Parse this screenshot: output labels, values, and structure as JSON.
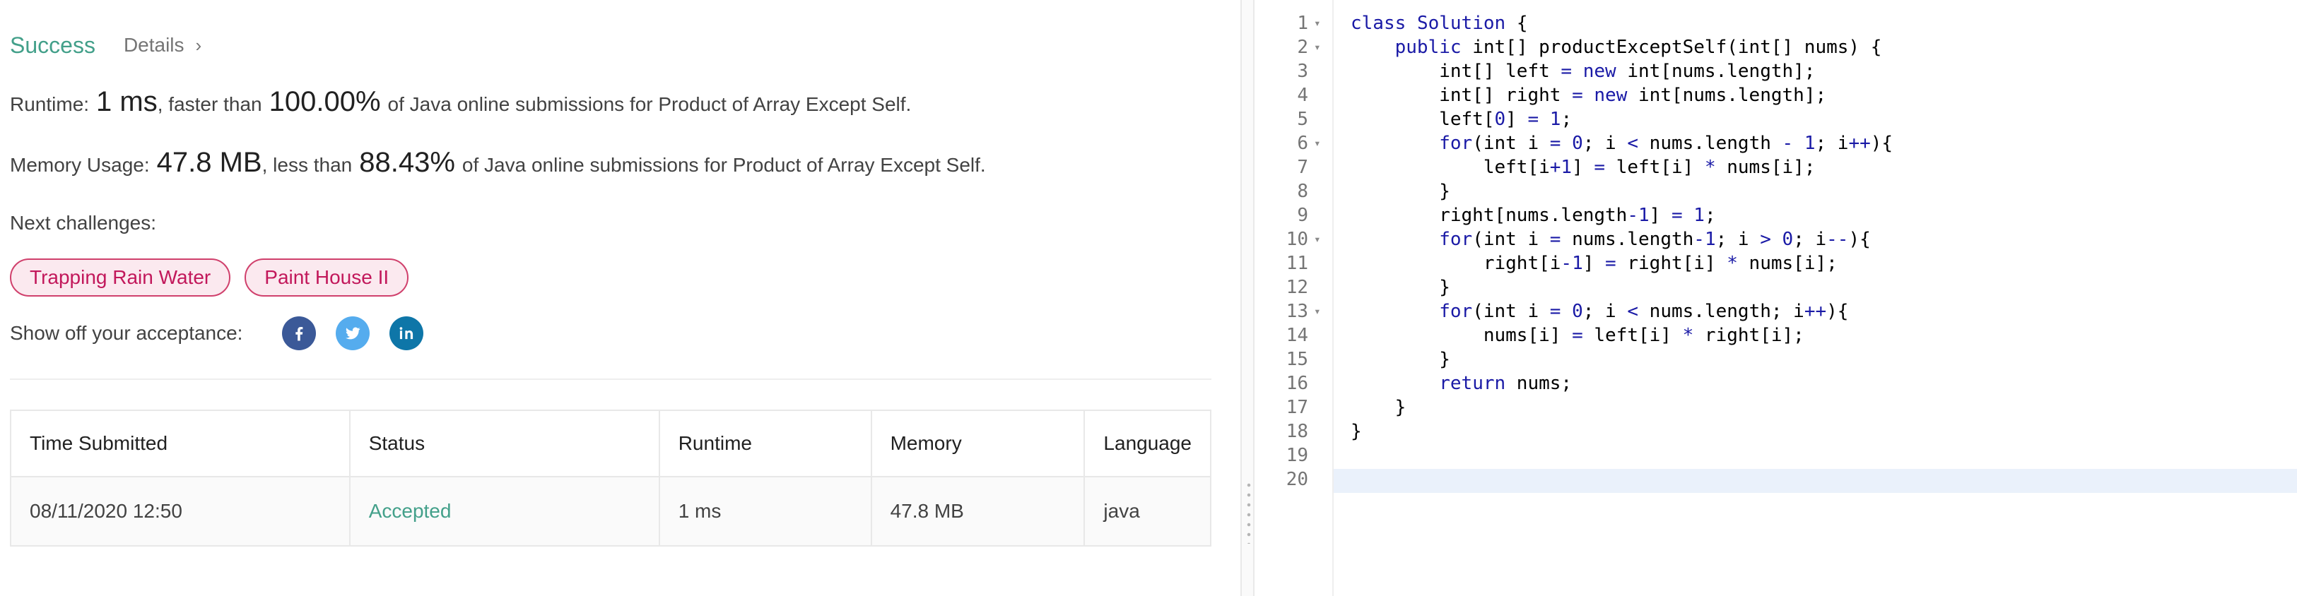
{
  "result": {
    "status": "Success",
    "details_label": "Details",
    "runtime": {
      "label": "Runtime:",
      "value": "1 ms",
      "mid": ", faster than",
      "percent": "100.00%",
      "suffix": "of Java online submissions for Product of Array Except Self."
    },
    "memory": {
      "label": "Memory Usage:",
      "value": "47.8 MB",
      "mid": ", less than",
      "percent": "88.43%",
      "suffix": "of Java online submissions for Product of Array Except Self."
    },
    "next_label": "Next challenges:",
    "challenges": [
      "Trapping Rain Water",
      "Paint House II"
    ],
    "share_label": "Show off your acceptance:",
    "social": [
      {
        "name": "facebook-icon",
        "color": "#3b5998"
      },
      {
        "name": "twitter-icon",
        "color": "#55acee"
      },
      {
        "name": "linkedin-icon",
        "color": "#0e76a8"
      }
    ]
  },
  "table": {
    "headers": [
      "Time Submitted",
      "Status",
      "Runtime",
      "Memory",
      "Language"
    ],
    "rows": [
      [
        "08/11/2020 12:50",
        "Accepted",
        "1 ms",
        "47.8 MB",
        "java"
      ]
    ]
  },
  "editor": {
    "lines": [
      {
        "n": "1",
        "fold": true,
        "code": "class Solution {"
      },
      {
        "n": "2",
        "fold": true,
        "code": "    public int[] productExceptSelf(int[] nums) {"
      },
      {
        "n": "3",
        "fold": false,
        "code": "        int[] left = new int[nums.length];"
      },
      {
        "n": "4",
        "fold": false,
        "code": "        int[] right = new int[nums.length];"
      },
      {
        "n": "5",
        "fold": false,
        "code": "        left[0] = 1;"
      },
      {
        "n": "6",
        "fold": true,
        "code": "        for(int i = 0; i < nums.length - 1; i++){"
      },
      {
        "n": "7",
        "fold": false,
        "code": "            left[i+1] = left[i] * nums[i];"
      },
      {
        "n": "8",
        "fold": false,
        "code": "        }"
      },
      {
        "n": "9",
        "fold": false,
        "code": "        right[nums.length-1] = 1;"
      },
      {
        "n": "10",
        "fold": true,
        "code": "        for(int i = nums.length-1; i > 0; i--){"
      },
      {
        "n": "11",
        "fold": false,
        "code": "            right[i-1] = right[i] * nums[i];"
      },
      {
        "n": "12",
        "fold": false,
        "code": "        }"
      },
      {
        "n": "13",
        "fold": true,
        "code": "        for(int i = 0; i < nums.length; i++){"
      },
      {
        "n": "14",
        "fold": false,
        "code": "            nums[i] = left[i] * right[i];"
      },
      {
        "n": "15",
        "fold": false,
        "code": "        }"
      },
      {
        "n": "16",
        "fold": false,
        "code": "        return nums;"
      },
      {
        "n": "17",
        "fold": false,
        "code": "    }"
      },
      {
        "n": "18",
        "fold": false,
        "code": "}"
      },
      {
        "n": "19",
        "fold": false,
        "code": ""
      },
      {
        "n": "20",
        "fold": false,
        "code": ""
      }
    ]
  }
}
